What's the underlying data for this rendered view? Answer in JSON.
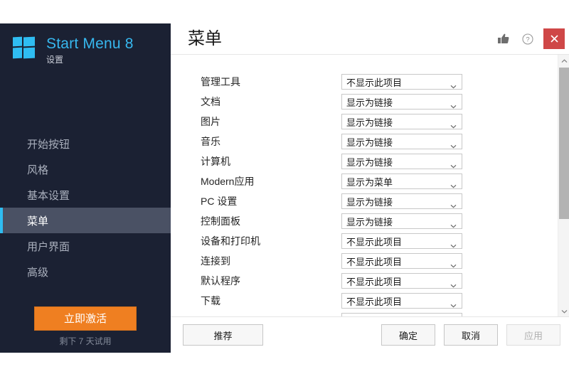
{
  "sidebar": {
    "brand": {
      "logo_icon": "windows-logo-icon",
      "title": "Start Menu 8",
      "subtitle": "设置"
    },
    "items": [
      {
        "label": "开始按钮",
        "active": false
      },
      {
        "label": "风格",
        "active": false
      },
      {
        "label": "基本设置",
        "active": false
      },
      {
        "label": "菜单",
        "active": true
      },
      {
        "label": "用户界面",
        "active": false
      },
      {
        "label": "高级",
        "active": false
      }
    ],
    "activate_button": "立即激活",
    "trial_text": "剩下 7 天试用",
    "accent_color": "#2fbdf2",
    "activate_color": "#ef7f21",
    "background_color": "#1b2133"
  },
  "header": {
    "title": "菜单",
    "thumbs_up_icon": "thumbs-up-icon",
    "help_icon": "help-circle-icon",
    "close_icon": "close-icon",
    "close_color": "#cf4747"
  },
  "main": {
    "rows": [
      {
        "label": "管理工具",
        "value": "不显示此项目"
      },
      {
        "label": "文档",
        "value": "显示为链接"
      },
      {
        "label": "图片",
        "value": "显示为链接"
      },
      {
        "label": "音乐",
        "value": "显示为链接"
      },
      {
        "label": "计算机",
        "value": "显示为链接"
      },
      {
        "label": "Modern应用",
        "value": "显示为菜单"
      },
      {
        "label": "PC 设置",
        "value": "显示为链接"
      },
      {
        "label": "控制面板",
        "value": "显示为链接"
      },
      {
        "label": "设备和打印机",
        "value": "不显示此项目"
      },
      {
        "label": "连接到",
        "value": "不显示此项目"
      },
      {
        "label": "默认程序",
        "value": "不显示此项目"
      },
      {
        "label": "下载",
        "value": "不显示此项目"
      },
      {
        "label": "",
        "value": ""
      }
    ],
    "dropdown_options": [
      "不显示此项目",
      "显示为链接",
      "显示为菜单"
    ],
    "scrollbar": {
      "up_arrow_icon": "chevron-up-icon",
      "down_arrow_icon": "chevron-down-icon"
    }
  },
  "footer": {
    "recommend_label": "推荐",
    "ok_label": "确定",
    "cancel_label": "取消",
    "apply_label": "应用",
    "apply_disabled": true
  }
}
